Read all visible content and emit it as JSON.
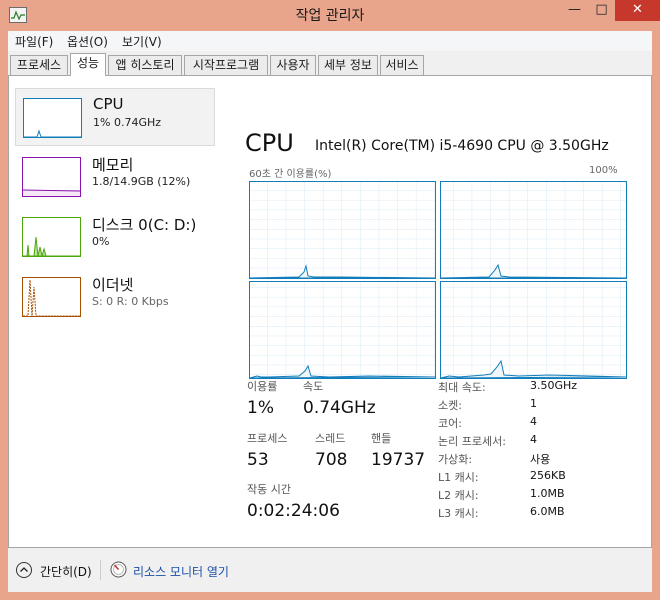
{
  "window": {
    "title": "작업 관리자",
    "minimize": "—",
    "maximize": "□",
    "close": "✕",
    "titlebar_color": "#e9a58c"
  },
  "menu": [
    "파일(F)",
    "옵션(O)",
    "보기(V)"
  ],
  "tabs": [
    {
      "label": "프로세스",
      "active": false
    },
    {
      "label": "성능",
      "active": true
    },
    {
      "label": "앱 히스토리",
      "active": false
    },
    {
      "label": "시작프로그램",
      "active": false
    },
    {
      "label": "사용자",
      "active": false
    },
    {
      "label": "세부 정보",
      "active": false
    },
    {
      "label": "서비스",
      "active": false
    }
  ],
  "sidebar": {
    "items": [
      {
        "name": "CPU",
        "sub": "1% 0.74GHz",
        "color": "#117dbb",
        "selected": true
      },
      {
        "name": "메모리",
        "sub": "1.8/14.9GB (12%)",
        "color": "#8b12ae",
        "selected": false
      },
      {
        "name": "디스크 0(C: D:)",
        "sub": "0%",
        "color": "#4da60c",
        "selected": false
      },
      {
        "name": "이더넷",
        "sub": "S: 0 R: 0 Kbps",
        "color": "#a74f01",
        "selected": false
      }
    ]
  },
  "cpu": {
    "title": "CPU",
    "model": "Intel(R) Core(TM) i5-4690 CPU @ 3.50GHz",
    "graph_left_label": "60초 간 이용률(%)",
    "graph_right_label": "100%",
    "graph_color": "#117dbb",
    "graph_fill": "#f1f6fa",
    "stats": {
      "utilization_label": "이용률",
      "utilization": "1%",
      "speed_label": "속도",
      "speed": "0.74GHz",
      "processes_label": "프로세스",
      "processes": "53",
      "threads_label": "스레드",
      "threads": "708",
      "handles_label": "핸들",
      "handles": "19737",
      "uptime_label": "작동 시간",
      "uptime": "0:02:24:06"
    },
    "specs": [
      {
        "label": "최대 속도:",
        "value": "3.50GHz"
      },
      {
        "label": "소켓:",
        "value": "1"
      },
      {
        "label": "코어:",
        "value": "4"
      },
      {
        "label": "논리 프로세서:",
        "value": "4"
      },
      {
        "label": "가상화:",
        "value": "사용"
      },
      {
        "label": "L1 캐시:",
        "value": "256KB"
      },
      {
        "label": "L2 캐시:",
        "value": "1.0MB"
      },
      {
        "label": "L3 캐시:",
        "value": "6.0MB"
      }
    ]
  },
  "footer": {
    "fewer_details": "간단히(D)",
    "resource_monitor": "리소스 모니터 열기"
  }
}
